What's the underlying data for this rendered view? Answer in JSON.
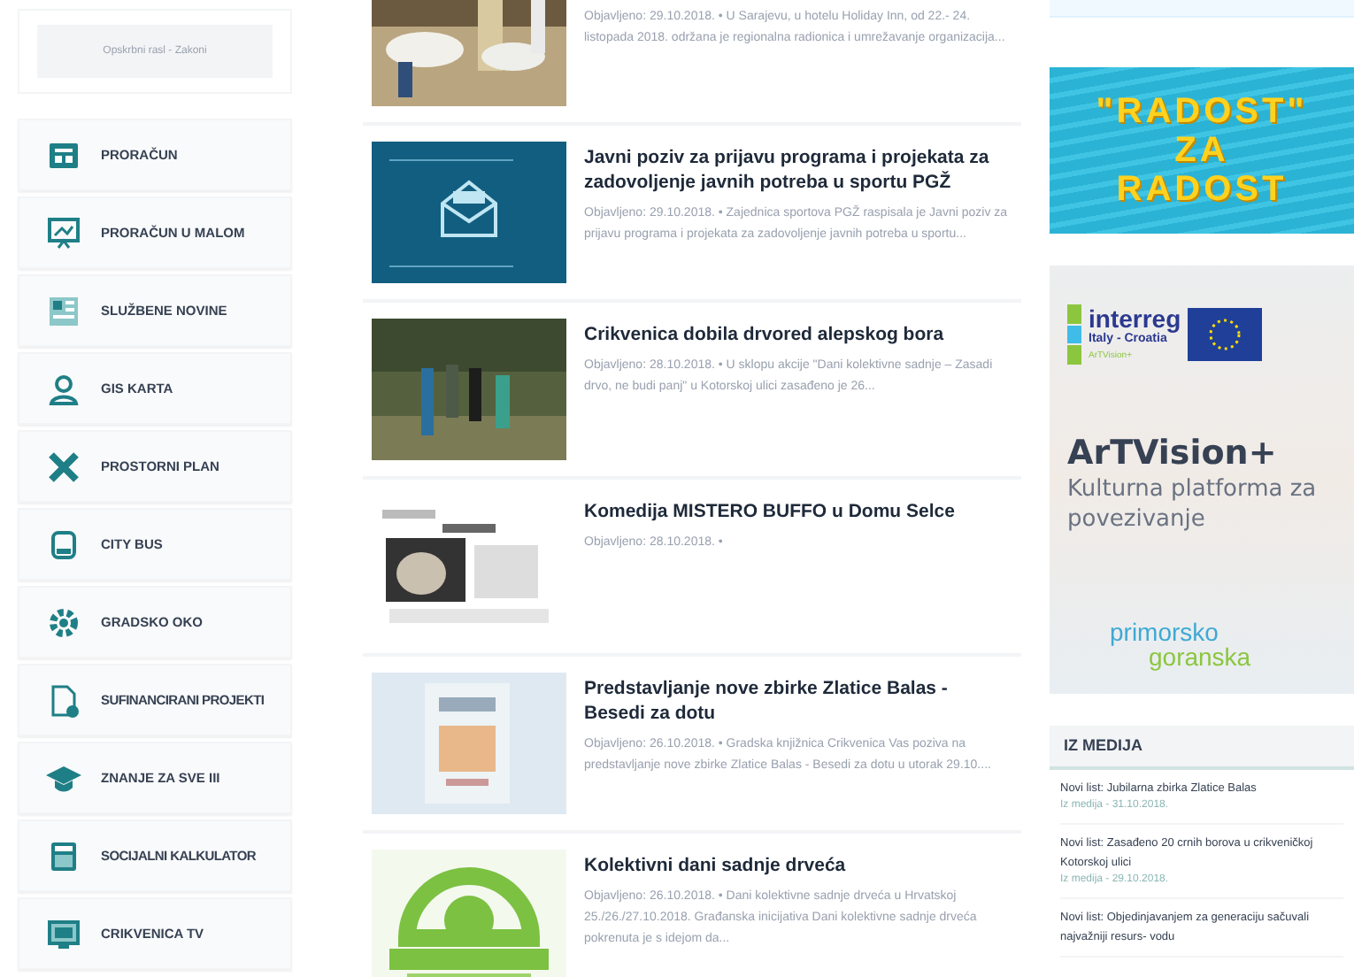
{
  "top_box": {
    "text": "Opskrbni rasl - Zakoni"
  },
  "sidebar": {
    "items": [
      {
        "label": "PRORAČUN"
      },
      {
        "label": "PRORAČUN U MALOM"
      },
      {
        "label": "SLUŽBENE NOVINE"
      },
      {
        "label": "GIS KARTA"
      },
      {
        "label": "PROSTORNI PLAN"
      },
      {
        "label": "CITY BUS"
      },
      {
        "label": "GRADSKO OKO"
      },
      {
        "label": "SUFINANCIRANI PROJEKTI"
      },
      {
        "label": "ZNANJE ZA SVE III"
      },
      {
        "label": "SOCIJALNI KALKULATOR"
      },
      {
        "label": "CRIKVENICA TV"
      }
    ]
  },
  "news": [
    {
      "desc": "Objavljeno: 29.10.2018. • U Sarajevu, u hotelu Holiday Inn, od 22.- 24. listopada 2018. održana je regionalna radionica i umrežavanje organizacija..."
    },
    {
      "title": "Javni poziv za prijavu programa i projekata za zadovoljenje javnih potreba u sportu PGŽ",
      "desc": "Objavljeno: 29.10.2018. • Zajednica sportova PGŽ raspisala je Javni poziv za prijavu programa i projekata za zadovoljenje javnih potreba u sportu..."
    },
    {
      "title": "Crikvenica dobila drvored alepskog bora",
      "desc": "Objavljeno: 28.10.2018. • U sklopu akcije \"Dani kolektivne sadnje – Zasadi drvo, ne budi panj\" u Kotorskoj ulici zasađeno je 26..."
    },
    {
      "title": "Komedija MISTERO BUFFO u Domu Selce",
      "desc": "Objavljeno: 28.10.2018. •"
    },
    {
      "title": "Predstavljanje nove zbirke Zlatice Balas - Besedi za dotu",
      "desc": "Objavljeno: 26.10.2018. • Gradska knjižnica Crikvenica Vas poziva na predstavljanje nove zbirke Zlatice Balas - Besedi za dotu u utorak 29.10...."
    },
    {
      "title": "Kolektivni dani sadnje drveća",
      "desc": "Objavljeno: 26.10.2018. • Dani kolektivne sadnje drveća u Hrvatskoj 25./26./27.10.2018. Građanska inicijativa Dani kolektivne sadnje drveća pokrenuta je s idejom da..."
    }
  ],
  "banners": [
    {
      "kind": "radost",
      "lines": [
        "\"RADOST\"",
        "ZA",
        "RADOST"
      ]
    },
    {
      "kind": "interreg",
      "brand": "interreg",
      "region": "Italy - Croatia",
      "project": "ArTVision+",
      "title": "ArTVision+",
      "subtitle": "Kulturna platforma za povezivanje",
      "partner_top": "primorsko",
      "partner_bottom": "goranska"
    }
  ],
  "media": {
    "heading": "IZ MEDIJA",
    "items": [
      {
        "title": "Novi list: Jubilarna zbirka Zlatice Balas",
        "meta": "Iz medija - 31.10.2018."
      },
      {
        "title": "Novi list: Zasađeno 20 crnih borova u crikveničkoj Kotorskoj ulici",
        "meta": "Iz medija - 29.10.2018."
      },
      {
        "title": "Novi list: Objedinjavanjem za generaciju sačuvali najvažniji resurs- vodu"
      }
    ]
  }
}
